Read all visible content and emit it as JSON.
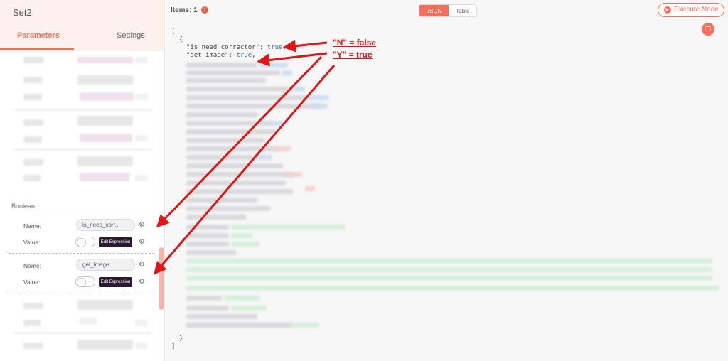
{
  "node": {
    "title": "Set2"
  },
  "tabs": {
    "parameters": "Parameters",
    "settings": "Settings"
  },
  "boolean": {
    "section_label": "Boolean:",
    "fields": [
      {
        "name_label": "Name:",
        "name_value": "is_need_corr...",
        "value_label": "Value:",
        "toggle_on": false,
        "edit_label": "Edit Expression"
      },
      {
        "name_label": "Name:",
        "name_value": "get_image",
        "value_label": "Value:",
        "toggle_on": false,
        "edit_label": "Edit Expression"
      }
    ]
  },
  "output": {
    "items_label": "Items: 1",
    "info_icon": "!",
    "view_json": "JSON",
    "view_table": "Table",
    "active_view": "JSON",
    "execute_label": "Execute Node",
    "json": {
      "open_bracket": "[",
      "open_brace": "{",
      "line1_key": "\"is_need_corrector\"",
      "line1_value": "true",
      "line2_key": "\"get_image\"",
      "line2_value": "true",
      "close_brace": "}",
      "close_bracket": "]"
    }
  },
  "annotations": {
    "note_n": "\"N\" = false",
    "note_y": "\"Y\" = true",
    "arrow_color": "#e01515"
  },
  "colors": {
    "accent": "#ff6d5a",
    "edit_button": "#2a1a2e",
    "json_bool": "#2f6fb5"
  },
  "icons": {
    "info": "info-icon",
    "execute": "play-circle-icon",
    "copy": "copy-icon",
    "gear": "gears-icon"
  }
}
